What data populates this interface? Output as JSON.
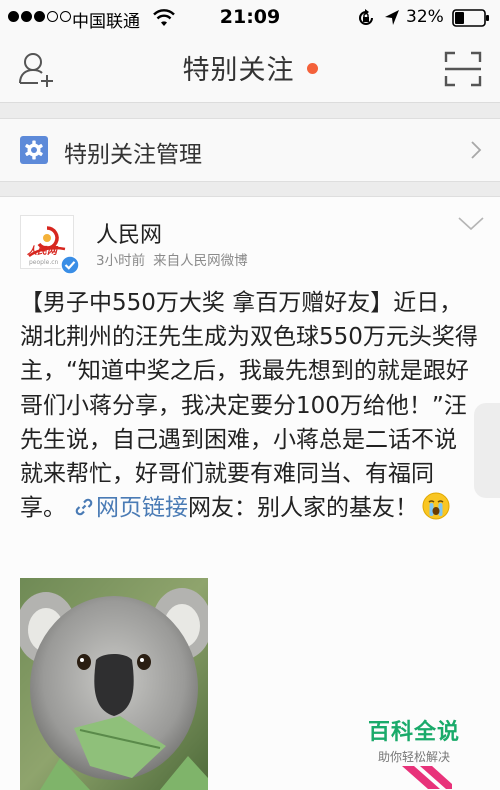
{
  "status_bar": {
    "carrier": "中国联通",
    "time": "21:09",
    "battery_percent": "32%",
    "signal_bars_filled": 3,
    "signal_bars_total": 5,
    "battery_level": 0.32
  },
  "nav": {
    "title": "特别关注",
    "has_unread_dot": true,
    "left_icon": "add-friend-icon",
    "right_icon": "scan-icon"
  },
  "manage": {
    "label": "特别关注管理",
    "icon": "gear-icon"
  },
  "post": {
    "author": "人民网",
    "time": "3小时前",
    "source": "来自人民网微博",
    "text_before_link": "【男子中550万大奖 拿百万赠好友】近日，湖北荆州的汪先生成为双色球550万元头奖得主，“知道中奖之后，我最先想到的就是跟好哥们小蒋分享，我决定要分100万给他！”汪先生说，自己遇到困难，小蒋总是二话不说就来帮忙，好哥们就要有难同当、有福同享。",
    "link_label": "网页链接",
    "text_after_link": "网友：别人家的基友！",
    "emoji": "crying-face-icon"
  },
  "watermark": {
    "title": "百科全说",
    "subtitle": "助你轻松解决"
  },
  "colors": {
    "accent_red": "#f4613a",
    "link_blue": "#4a7bb5",
    "gear_blue": "#5d8ad9",
    "watermark_green": "#1aaa6a"
  }
}
